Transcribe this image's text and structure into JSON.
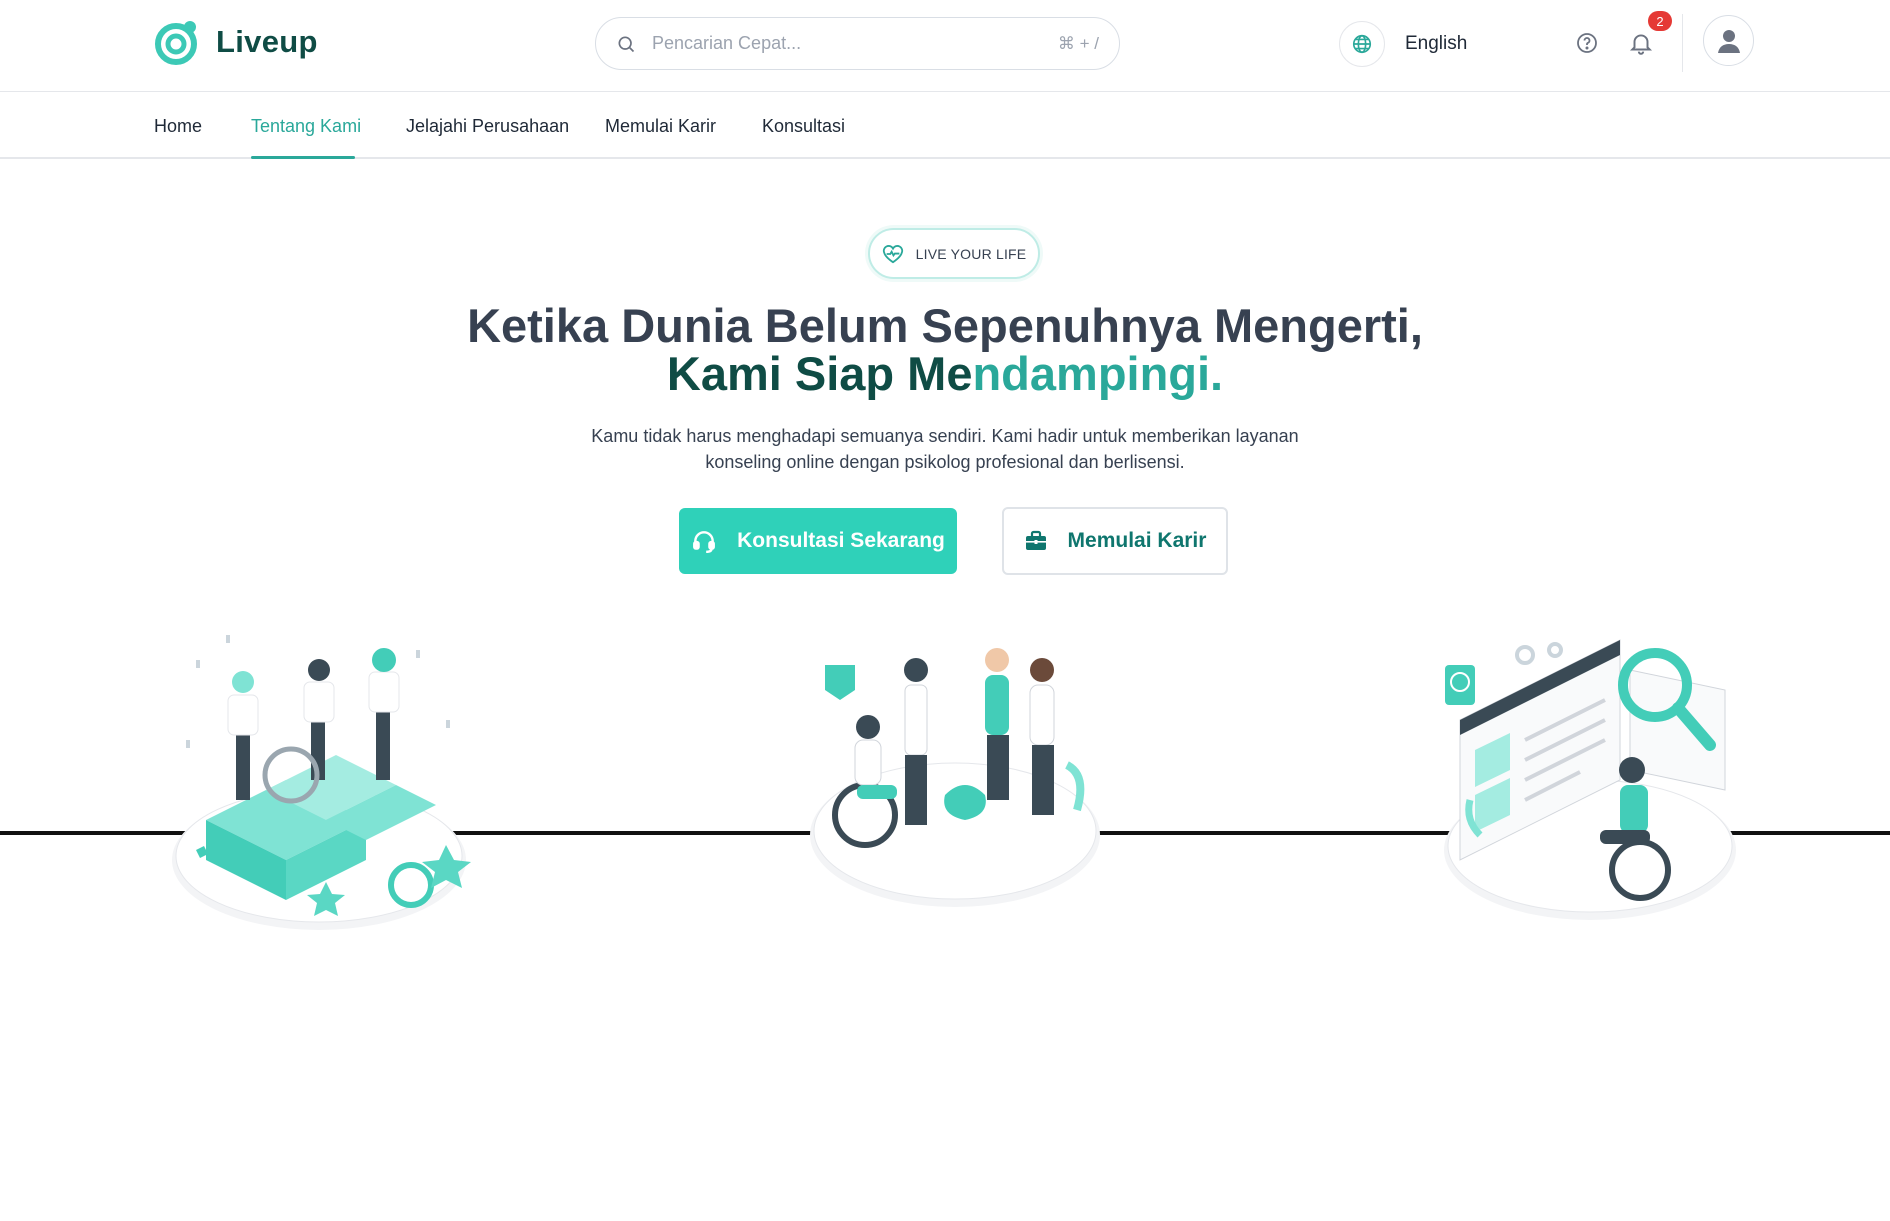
{
  "header": {
    "logo_text": "Liveup",
    "search": {
      "placeholder": "Pencarian Cepat...",
      "shortcut": "⌘ + /"
    },
    "language": "English",
    "notifications_count": "2"
  },
  "nav": {
    "items": [
      {
        "label": "Home",
        "active": false
      },
      {
        "label": "Tentang Kami",
        "active": true
      },
      {
        "label": "Jelajahi Perusahaan",
        "active": false
      },
      {
        "label": "Memulai Karir",
        "active": false
      },
      {
        "label": "Konsultasi",
        "active": false
      }
    ]
  },
  "hero": {
    "tagline": "LIVE YOUR LIFE",
    "headline_line1": "Ketika Dunia Belum Sepenuhnya Mengerti,",
    "headline_line2_part1": "Kami Siap Me",
    "headline_line2_part2": "ndampingi.",
    "subtext": "Kamu tidak harus menghadapi semuanya sendiri. Kami hadir untuk memberikan layanan konseling online dengan psikolog profesional dan berlisensi.",
    "primary_button": "Konsultasi Sekarang",
    "secondary_button": "Memulai Karir"
  },
  "colors": {
    "brand_teal": "#2fd1b9",
    "brand_dark": "#0f4c45",
    "accent_text": "#2aa89a",
    "badge_red": "#e53935"
  },
  "icons": {
    "search": "search-icon",
    "language": "globe-icon",
    "help": "help-circle-icon",
    "notifications": "bell-icon",
    "avatar": "user-icon",
    "tagline": "heart-pulse-icon",
    "primary_button": "headset-icon",
    "secondary_button": "briefcase-icon"
  }
}
